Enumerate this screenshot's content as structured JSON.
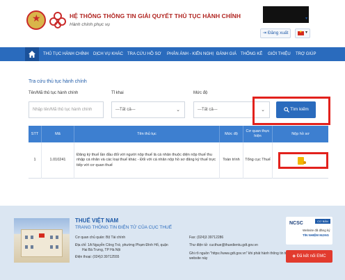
{
  "header": {
    "site_title": "HỆ THỐNG THÔNG TIN GIẢI QUYẾT THỦ TỤC HÀNH CHÍNH",
    "site_subtitle": "Hành chính phục vụ",
    "logout_label": "Đăng xuất",
    "language": "vi"
  },
  "nav": {
    "home_icon": "home-icon",
    "items": [
      "THỦ TỤC HÀNH CHÍNH",
      "DỊCH VỤ KHÁC",
      "TRA CỨU HỒ SƠ",
      "PHẢN ÁNH - KIẾN NGHỊ",
      "ĐÁNH GIÁ",
      "THỐNG KÊ",
      "GIỚI THIỆU",
      "TRỢ GIÚP"
    ]
  },
  "search": {
    "section_title": "Tra cứu thủ tục hành chính",
    "name_label": "Tên/Mã thủ tục hành chính",
    "name_placeholder": "Nhập tên/Mã thủ tục hành chính",
    "field_label": "Tỉ khai",
    "field_value": "---Tất cả---",
    "level_label": "Mức độ",
    "level_value": "---Tất cả---",
    "button_label": "Tìm kiếm"
  },
  "table": {
    "headers": [
      "STT",
      "Mã",
      "Tên thủ tục",
      "Mức độ",
      "Cơ quan thực hiện",
      "Nộp hồ sơ"
    ],
    "rows": [
      {
        "stt": "1",
        "code": "1.010241",
        "name": "Đăng ký thuế lần đầu đối với người nộp thuế là cá nhân thuộc diện nộp thuế thu nhập cá nhân và các loại thuế khác - Đối với cá nhân nộp hồ sơ đăng ký thuế trực tiếp với cơ quan thuế",
        "level": "Toàn trình",
        "agency": "Tổng cục Thuế",
        "submit_icon": "submit-document-icon"
      }
    ]
  },
  "footer": {
    "org_title": "THUẾ VIỆT NAM",
    "org_subtitle": "TRANG THÔNG TIN ĐIỆN TỬ CỦA CỤC THUẾ",
    "line1": "Cơ quan chủ quản: Bộ Tài chính",
    "line2": "Địa chỉ: 1A Nguyễn Công Trứ, phường Phạm Đình Hổ, quận",
    "line3": "Hai Bà Trưng, TP Hà Nội",
    "line4": "Điện thoại: (024)3 39712555",
    "fax": "Fax: (024)3 39712286",
    "email": "Thư điện tử: cucthue@thuedientu.gdt.gov.vn",
    "note1": "Ghi rõ nguồn \"https://www.gdt.gov.vn\" khi phát hành thông tin từ",
    "note2": "website này",
    "ncsc_logo": "NCSC",
    "ncsc_badge": "CƠ BẢN",
    "ncsc_text1": "Website đã đăng ký",
    "ncsc_text2": "TÍN NHIỆM MẠNG",
    "emc_label": "Đã kết nối EMC"
  }
}
